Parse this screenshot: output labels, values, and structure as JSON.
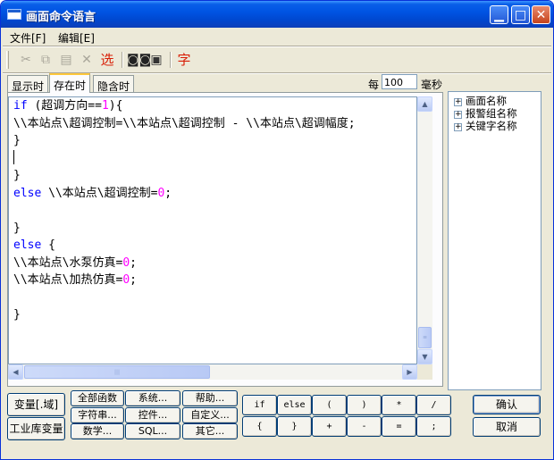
{
  "window": {
    "title": "画面命令语言"
  },
  "menu": [
    "文件[F]",
    "编辑[E]"
  ],
  "toolbar": {
    "icons": [
      "scissors-icon",
      "copy-icon",
      "paste-icon",
      "delete-icon",
      "select-icon",
      "binoculars-icon",
      "replace-icon",
      "font-icon"
    ],
    "select_label": "选",
    "font_label": "字"
  },
  "tabs": [
    "显示时",
    "存在时",
    "隐含时"
  ],
  "active_tab": "存在时",
  "period": {
    "label": "每",
    "value": "100",
    "unit": "毫秒"
  },
  "code_lines": [
    [
      [
        "kw",
        "if "
      ],
      [
        "",
        "(超调方向=="
      ],
      [
        "num",
        "1"
      ],
      [
        "",
        "){"
      ]
    ],
    [
      [
        "",
        "\\\\本站点\\超调控制=\\\\本站点\\超调控制 - \\\\本站点\\超调幅度;"
      ]
    ],
    [
      [
        "",
        "}"
      ]
    ],
    [
      [
        "caret",
        ""
      ]
    ],
    [
      [
        "",
        "}"
      ]
    ],
    [
      [
        "kw",
        "else "
      ],
      [
        "",
        "\\\\本站点\\超调控制="
      ],
      [
        "num",
        "0"
      ],
      [
        "",
        ";"
      ]
    ],
    [
      [
        "",
        ""
      ]
    ],
    [
      [
        "",
        "}"
      ]
    ],
    [
      [
        "kw",
        "else "
      ],
      [
        "",
        "{"
      ]
    ],
    [
      [
        "",
        "\\\\本站点\\水泵仿真="
      ],
      [
        "num",
        "0"
      ],
      [
        "",
        ";"
      ]
    ],
    [
      [
        "",
        "\\\\本站点\\加热仿真="
      ],
      [
        "num",
        "0"
      ],
      [
        "",
        ";"
      ]
    ],
    [
      [
        "",
        ""
      ]
    ],
    [
      [
        "",
        "}"
      ]
    ]
  ],
  "tree": [
    "画面名称",
    "报警组名称",
    "关键字名称"
  ],
  "buttons": {
    "var_domain": "变量[.域]",
    "industrial_var": "工业库变量",
    "all_functions": "全部函数",
    "system": "系统...",
    "help": "帮助...",
    "string": "字符串...",
    "control": "控件...",
    "custom": "自定义...",
    "math": "数学...",
    "sql": "SQL...",
    "other": "其它...",
    "confirm": "确认",
    "cancel": "取消"
  },
  "operators": [
    "if",
    "else",
    "(",
    ")",
    "*",
    "/",
    "{",
    "}",
    "+",
    "-",
    "=",
    ";"
  ]
}
